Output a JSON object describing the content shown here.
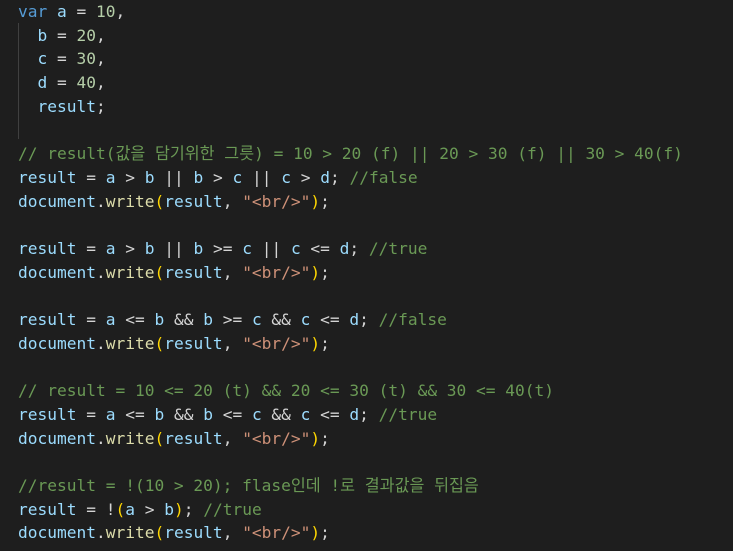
{
  "editor": {
    "lines": [
      {
        "tokens": [
          {
            "t": "var",
            "c": "kw"
          },
          {
            "t": " "
          },
          {
            "t": "a",
            "c": "var"
          },
          {
            "t": " = "
          },
          {
            "t": "10",
            "c": "num"
          },
          {
            "t": ","
          }
        ]
      },
      {
        "tokens": [
          {
            "t": "  "
          },
          {
            "t": "b",
            "c": "var"
          },
          {
            "t": " = "
          },
          {
            "t": "20",
            "c": "num"
          },
          {
            "t": ","
          }
        ]
      },
      {
        "tokens": [
          {
            "t": "  "
          },
          {
            "t": "c",
            "c": "var"
          },
          {
            "t": " = "
          },
          {
            "t": "30",
            "c": "num"
          },
          {
            "t": ","
          }
        ]
      },
      {
        "tokens": [
          {
            "t": "  "
          },
          {
            "t": "d",
            "c": "var"
          },
          {
            "t": " = "
          },
          {
            "t": "40",
            "c": "num"
          },
          {
            "t": ","
          }
        ]
      },
      {
        "tokens": [
          {
            "t": "  "
          },
          {
            "t": "result",
            "c": "var"
          },
          {
            "t": ";"
          }
        ]
      },
      {
        "tokens": []
      },
      {
        "tokens": [
          {
            "t": "// result(값을 담기위한 그릇) = 10 > 20 (f) || 20 > 30 (f) || 30 > 40(f)",
            "c": "cm"
          }
        ]
      },
      {
        "tokens": [
          {
            "t": "result",
            "c": "var"
          },
          {
            "t": " = "
          },
          {
            "t": "a",
            "c": "var"
          },
          {
            "t": " > "
          },
          {
            "t": "b",
            "c": "var"
          },
          {
            "t": " || "
          },
          {
            "t": "b",
            "c": "var"
          },
          {
            "t": " > "
          },
          {
            "t": "c",
            "c": "var"
          },
          {
            "t": " || "
          },
          {
            "t": "c",
            "c": "var"
          },
          {
            "t": " > "
          },
          {
            "t": "d",
            "c": "var"
          },
          {
            "t": "; "
          },
          {
            "t": "//false",
            "c": "cm"
          }
        ]
      },
      {
        "tokens": [
          {
            "t": "document",
            "c": "var"
          },
          {
            "t": "."
          },
          {
            "t": "write",
            "c": "fn"
          },
          {
            "t": "(",
            "c": "p1"
          },
          {
            "t": "result",
            "c": "var"
          },
          {
            "t": ", "
          },
          {
            "t": "\"<br/>\"",
            "c": "str"
          },
          {
            "t": ")",
            "c": "p1"
          },
          {
            "t": ";"
          }
        ]
      },
      {
        "tokens": []
      },
      {
        "tokens": [
          {
            "t": "result",
            "c": "var"
          },
          {
            "t": " = "
          },
          {
            "t": "a",
            "c": "var"
          },
          {
            "t": " > "
          },
          {
            "t": "b",
            "c": "var"
          },
          {
            "t": " || "
          },
          {
            "t": "b",
            "c": "var"
          },
          {
            "t": " >= "
          },
          {
            "t": "c",
            "c": "var"
          },
          {
            "t": " || "
          },
          {
            "t": "c",
            "c": "var"
          },
          {
            "t": " <= "
          },
          {
            "t": "d",
            "c": "var"
          },
          {
            "t": "; "
          },
          {
            "t": "//true",
            "c": "cm"
          }
        ]
      },
      {
        "tokens": [
          {
            "t": "document",
            "c": "var"
          },
          {
            "t": "."
          },
          {
            "t": "write",
            "c": "fn"
          },
          {
            "t": "(",
            "c": "p1"
          },
          {
            "t": "result",
            "c": "var"
          },
          {
            "t": ", "
          },
          {
            "t": "\"<br/>\"",
            "c": "str"
          },
          {
            "t": ")",
            "c": "p1"
          },
          {
            "t": ";"
          }
        ]
      },
      {
        "tokens": []
      },
      {
        "tokens": [
          {
            "t": "result",
            "c": "var"
          },
          {
            "t": " = "
          },
          {
            "t": "a",
            "c": "var"
          },
          {
            "t": " <= "
          },
          {
            "t": "b",
            "c": "var"
          },
          {
            "t": " && "
          },
          {
            "t": "b",
            "c": "var"
          },
          {
            "t": " >= "
          },
          {
            "t": "c",
            "c": "var"
          },
          {
            "t": " && "
          },
          {
            "t": "c",
            "c": "var"
          },
          {
            "t": " <= "
          },
          {
            "t": "d",
            "c": "var"
          },
          {
            "t": "; "
          },
          {
            "t": "//false",
            "c": "cm"
          }
        ]
      },
      {
        "tokens": [
          {
            "t": "document",
            "c": "var"
          },
          {
            "t": "."
          },
          {
            "t": "write",
            "c": "fn"
          },
          {
            "t": "(",
            "c": "p1"
          },
          {
            "t": "result",
            "c": "var"
          },
          {
            "t": ", "
          },
          {
            "t": "\"<br/>\"",
            "c": "str"
          },
          {
            "t": ")",
            "c": "p1"
          },
          {
            "t": ";"
          }
        ]
      },
      {
        "tokens": []
      },
      {
        "tokens": [
          {
            "t": "// result = 10 <= 20 (t) && 20 <= 30 (t) && 30 <= 40(t)",
            "c": "cm"
          }
        ]
      },
      {
        "tokens": [
          {
            "t": "result",
            "c": "var"
          },
          {
            "t": " = "
          },
          {
            "t": "a",
            "c": "var"
          },
          {
            "t": " <= "
          },
          {
            "t": "b",
            "c": "var"
          },
          {
            "t": " && "
          },
          {
            "t": "b",
            "c": "var"
          },
          {
            "t": " <= "
          },
          {
            "t": "c",
            "c": "var"
          },
          {
            "t": " && "
          },
          {
            "t": "c",
            "c": "var"
          },
          {
            "t": " <= "
          },
          {
            "t": "d",
            "c": "var"
          },
          {
            "t": "; "
          },
          {
            "t": "//true",
            "c": "cm"
          }
        ]
      },
      {
        "tokens": [
          {
            "t": "document",
            "c": "var"
          },
          {
            "t": "."
          },
          {
            "t": "write",
            "c": "fn"
          },
          {
            "t": "(",
            "c": "p1"
          },
          {
            "t": "result",
            "c": "var"
          },
          {
            "t": ", "
          },
          {
            "t": "\"<br/>\"",
            "c": "str"
          },
          {
            "t": ")",
            "c": "p1"
          },
          {
            "t": ";"
          }
        ]
      },
      {
        "tokens": []
      },
      {
        "tokens": [
          {
            "t": "//result = !(10 > 20); flase인데 !로 결과값을 뒤집음",
            "c": "cm"
          }
        ]
      },
      {
        "tokens": [
          {
            "t": "result",
            "c": "var"
          },
          {
            "t": " = !"
          },
          {
            "t": "(",
            "c": "p1"
          },
          {
            "t": "a",
            "c": "var"
          },
          {
            "t": " > "
          },
          {
            "t": "b",
            "c": "var"
          },
          {
            "t": ")",
            "c": "p1"
          },
          {
            "t": "; "
          },
          {
            "t": "//true",
            "c": "cm"
          }
        ]
      },
      {
        "tokens": [
          {
            "t": "document",
            "c": "var"
          },
          {
            "t": "."
          },
          {
            "t": "write",
            "c": "fn"
          },
          {
            "t": "(",
            "c": "p1"
          },
          {
            "t": "result",
            "c": "var"
          },
          {
            "t": ", "
          },
          {
            "t": "\"<br/>\"",
            "c": "str"
          },
          {
            "t": ")",
            "c": "p1"
          },
          {
            "t": ";"
          }
        ]
      }
    ]
  },
  "colors": {
    "background": "#1e1e1e",
    "keyword": "#569cd6",
    "variable": "#9cdcfe",
    "number": "#b5cea8",
    "comment": "#6a9955",
    "function": "#dcdcaa",
    "string": "#ce9178",
    "bracket": "#ffd700"
  }
}
